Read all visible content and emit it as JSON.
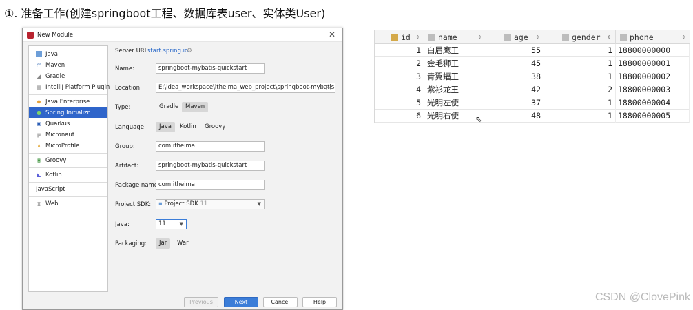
{
  "heading": "①. 准备工作(创建springboot工程、数据库表user、实体类User)",
  "dialog": {
    "title": "New Module",
    "sidebar": {
      "items": [
        {
          "label": "Java",
          "icon": "folder-icon"
        },
        {
          "label": "Maven",
          "icon": "maven-icon"
        },
        {
          "label": "Gradle",
          "icon": "gradle-icon"
        },
        {
          "label": "IntelliJ Platform Plugin",
          "icon": "plugin-icon"
        },
        {
          "label": "Java Enterprise",
          "icon": "java-ee-icon"
        },
        {
          "label": "Spring Initializr",
          "icon": "spring-icon",
          "selected": true
        },
        {
          "label": "Quarkus",
          "icon": "quarkus-icon"
        },
        {
          "label": "Micronaut",
          "icon": "micronaut-icon"
        },
        {
          "label": "MicroProfile",
          "icon": "microprofile-icon"
        },
        {
          "label": "Groovy",
          "icon": "groovy-icon"
        },
        {
          "label": "Kotlin",
          "icon": "kotlin-icon"
        },
        {
          "label": "JavaScript",
          "icon": ""
        },
        {
          "label": "Web",
          "icon": "web-icon"
        }
      ]
    },
    "form": {
      "server_url_label": "Server URL:",
      "server_url": "start.spring.io",
      "name_label": "Name:",
      "name": "springboot-mybatis-quickstart",
      "location_label": "Location:",
      "location": "E:\\idea_workspace\\itheima_web_project\\springboot-mybatis-quic",
      "type_label": "Type:",
      "type_options": [
        "Gradle",
        "Maven"
      ],
      "language_label": "Language:",
      "language_options": [
        "Java",
        "Kotlin",
        "Groovy"
      ],
      "group_label": "Group:",
      "group": "com.itheima",
      "artifact_label": "Artifact:",
      "artifact": "springboot-mybatis-quickstart",
      "package_label": "Package name:",
      "package": "com.itheima",
      "sdk_label": "Project SDK:",
      "sdk": "Project SDK",
      "sdk_version": "11",
      "java_label": "Java:",
      "java": "11",
      "packaging_label": "Packaging:",
      "packaging_options": [
        "Jar",
        "War"
      ]
    },
    "buttons": {
      "previous": "Previous",
      "next": "Next",
      "cancel": "Cancel",
      "help": "Help"
    }
  },
  "table": {
    "columns": [
      "id",
      "name",
      "age",
      "gender",
      "phone"
    ],
    "rows": [
      {
        "id": "1",
        "name": "白眉鹰王",
        "age": "55",
        "gender": "1",
        "phone": "18800000000"
      },
      {
        "id": "2",
        "name": "金毛狮王",
        "age": "45",
        "gender": "1",
        "phone": "18800000001"
      },
      {
        "id": "3",
        "name": "青翼蝠王",
        "age": "38",
        "gender": "1",
        "phone": "18800000002"
      },
      {
        "id": "4",
        "name": "紫衫龙王",
        "age": "42",
        "gender": "2",
        "phone": "18800000003"
      },
      {
        "id": "5",
        "name": "光明左使",
        "age": "37",
        "gender": "1",
        "phone": "18800000004"
      },
      {
        "id": "6",
        "name": "光明右使",
        "age": "48",
        "gender": "1",
        "phone": "18800000005"
      }
    ]
  },
  "watermark": "CSDN @ClovePink"
}
